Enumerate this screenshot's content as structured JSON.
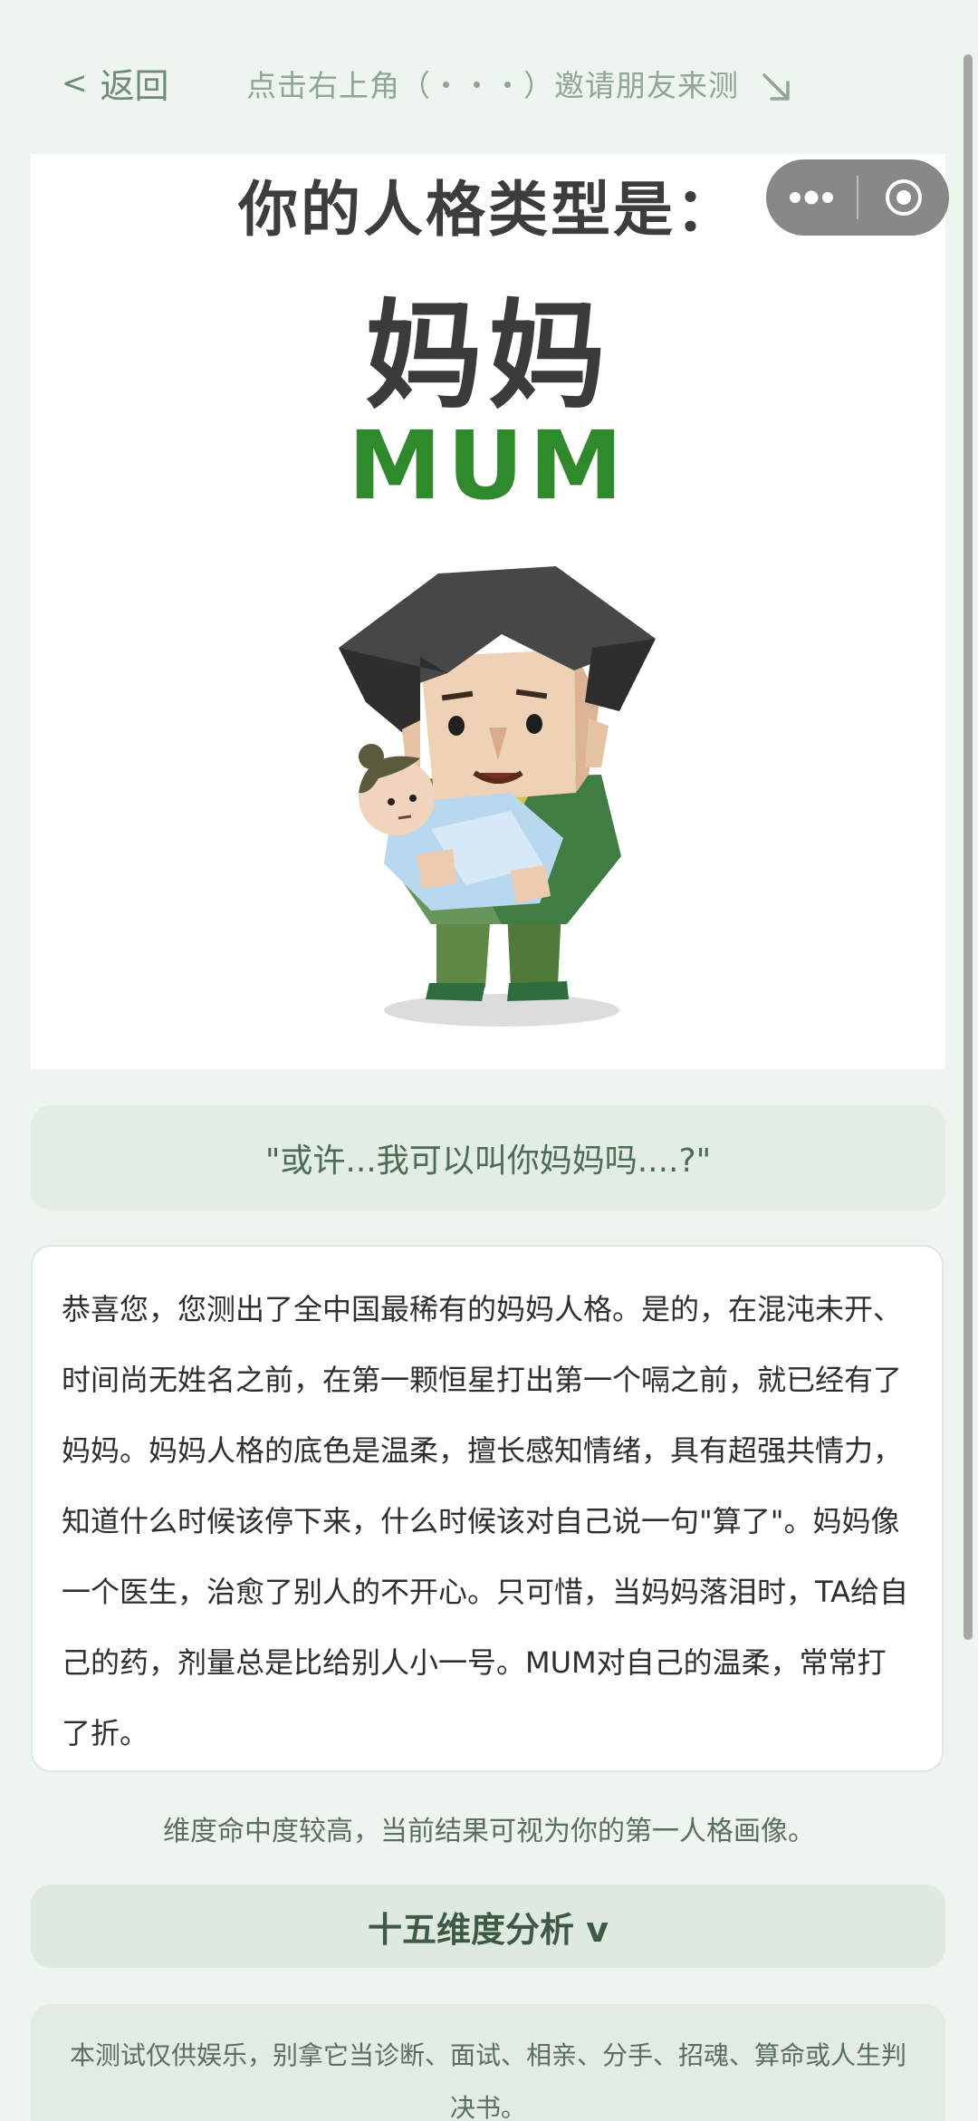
{
  "nav": {
    "back_label": "返回",
    "invite_hint": "点击右上角（・・・）邀请朋友来测"
  },
  "result": {
    "heading": "你的人格类型是：",
    "type_name": "妈妈",
    "type_code": "MUM"
  },
  "quote": "\"或许...我可以叫你妈妈吗....?\"",
  "description": "恭喜您，您测出了全中国最稀有的妈妈人格。是的，在混沌未开、时间尚无姓名之前，在第一颗恒星打出第一个嗝之前，就已经有了妈妈。妈妈人格的底色是温柔，擅长感知情绪，具有超强共情力，知道什么时候该停下来，什么时候该对自己说一句\"算了\"。妈妈像一个医生，治愈了别人的不开心。只可惜，当妈妈落泪时，TA给自己的药，剂量总是比给别人小一号。MUM对自己的温柔，常常打了折。",
  "note": "维度命中度较高，当前结果可视为你的第一人格画像。",
  "analysis_label": "十五维度分析 v",
  "disclaimer": "本测试仅供娱乐，别拿它当诊断、面试、相亲、分手、招魂、算命或人生判决书。",
  "colors": {
    "page_bg": "#eef4ee",
    "accent_green": "#2f8a2c",
    "muted_green": "#6f8b78"
  },
  "icons": {
    "back": "chevron-left-icon",
    "invite_arrow": "arrow-down-right-icon",
    "capsule_more": "more-dots-icon",
    "capsule_close": "target-close-icon"
  }
}
